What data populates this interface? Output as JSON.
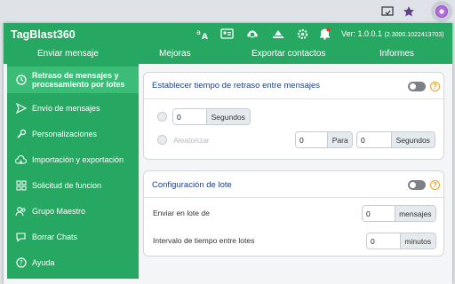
{
  "browser": {
    "icons": [
      "cast-icon",
      "star-icon",
      "extension-icon"
    ]
  },
  "header": {
    "brand": "TagBlast360",
    "version_label": "Ver: 1.0.0.1",
    "version_build": "(2.3000.1022413703)",
    "nav": [
      {
        "label": "Enviar mensaje"
      },
      {
        "label": "Mejoras"
      },
      {
        "label": "Exportar contactos"
      },
      {
        "label": "Informes"
      }
    ]
  },
  "sidebar": {
    "items": [
      {
        "label": "Retraso de mensajes y procesamiento por lotes",
        "icon": "clock-icon",
        "active": true
      },
      {
        "label": "Envío de mensajes",
        "icon": "send-icon"
      },
      {
        "label": "Personalizaciones",
        "icon": "wrench-icon"
      },
      {
        "label": "Importación y exportación",
        "icon": "cloud-icon"
      },
      {
        "label": "Solicitud de funcion",
        "icon": "grid-icon"
      },
      {
        "label": "Grupo Maestro",
        "icon": "users-icon"
      },
      {
        "label": "Borrar Chats",
        "icon": "chat-icon"
      },
      {
        "label": "Ayuda",
        "icon": "help-icon"
      }
    ]
  },
  "delay_card": {
    "title": "Establecer tiempo de retraso entre mensajes",
    "toggle_on": false,
    "fixed_value": "0",
    "fixed_unit": "Segundos",
    "randomize_label": "Aleatorizar",
    "random_from": "0",
    "random_to_label": "Para",
    "random_to": "0",
    "random_unit": "Segundos"
  },
  "batch_card": {
    "title": "Configuración de lote",
    "toggle_on": false,
    "batch_label": "Enviar en lote de",
    "batch_value": "0",
    "batch_unit": "mensajes",
    "interval_label": "Intervalo de tiempo entre lotes",
    "interval_value": "0",
    "interval_unit": "minutos"
  },
  "colors": {
    "brand_green": "#26a862",
    "active_green": "#3bbd77",
    "title_blue": "#1f3f88",
    "help_orange": "#f0a020"
  }
}
